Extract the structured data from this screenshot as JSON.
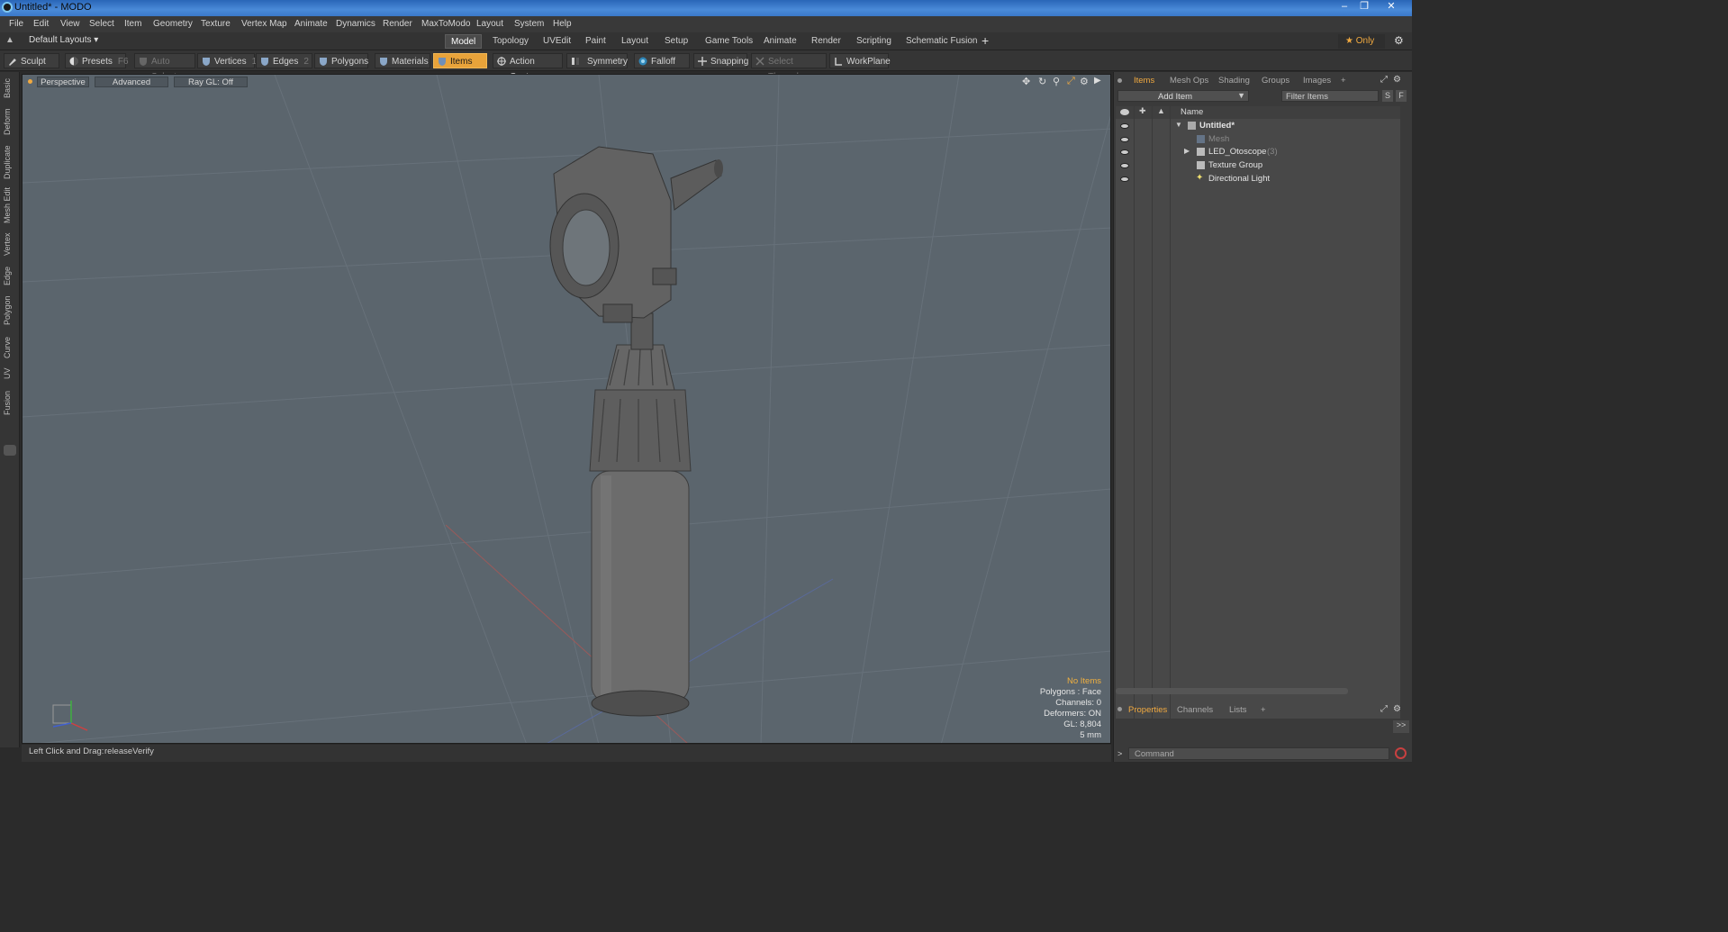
{
  "window": {
    "title": "Untitled* - MODO",
    "minimize": "‒",
    "restore": "❐",
    "close": "✕"
  },
  "menu": [
    "File",
    "Edit",
    "View",
    "Select",
    "Item",
    "Geometry",
    "Texture",
    "Vertex Map",
    "Animate",
    "Dynamics",
    "Render",
    "MaxToModo",
    "Layout",
    "System",
    "Help"
  ],
  "layout_selector": "Default Layouts ▾",
  "layout_tabs": [
    "Model",
    "Topology",
    "UVEdit",
    "Paint",
    "Layout",
    "Setup",
    "Game Tools",
    "Animate",
    "Render",
    "Scripting",
    "Schematic Fusion"
  ],
  "layout_tabs_active": "Model",
  "add_tab": "+",
  "only_label": "★  Only",
  "toolbar": {
    "sculpt": "Sculpt",
    "presets": "Presets",
    "presets_key": "F6",
    "auto_select": "Auto Select",
    "vertices": "Vertices",
    "vertices_count": "1",
    "edges": "Edges",
    "edges_count": "2",
    "polygons": "Polygons",
    "materials": "Materials",
    "items": "Items",
    "action_center": "Action Center",
    "symmetry": "Symmetry",
    "falloff": "Falloff",
    "snapping": "Snapping",
    "select_through": "Select Through",
    "workplane": "WorkPlane"
  },
  "left_tabs": [
    "Basic",
    "Deform",
    "Duplicate",
    "Mesh Edit",
    "Vertex",
    "Edge",
    "Polygon",
    "Curve",
    "UV",
    "Fusion"
  ],
  "viewport": {
    "perspective": "Perspective",
    "advanced": "Advanced",
    "raygl": "Ray GL: Off",
    "hud": {
      "no_items": "No Items",
      "polygons": "Polygons : Face",
      "channels": "Channels: 0",
      "deformers": "Deformers: ON",
      "gl": "GL: 8,804",
      "scale": "5 mm"
    }
  },
  "status": {
    "hint": "Left Click and Drag:",
    "value": "releaseVerify"
  },
  "right_panel": {
    "tabs": [
      "Items",
      "Mesh Ops",
      "Shading",
      "Groups",
      "Images",
      "+"
    ],
    "active_tab": "Items",
    "add_item": "Add Item",
    "filter_items": "Filter Items",
    "s_btn": "S",
    "f_btn": "F",
    "name_header": "Name",
    "items": [
      {
        "label": "Untitled*",
        "count": ""
      },
      {
        "label": "Mesh",
        "count": ""
      },
      {
        "label": "LED_Otoscope",
        "count": "(3)"
      },
      {
        "label": "Texture Group",
        "count": ""
      },
      {
        "label": "Directional Light",
        "count": ""
      }
    ],
    "bottom_tabs": [
      "Properties",
      "Channels",
      "Lists",
      "+"
    ],
    "bottom_active": "Properties",
    "command_placeholder": "Command",
    "expand": ">>"
  },
  "colors": {
    "accent": "#f0a940",
    "viewport_bg": "#5b656d",
    "active_tool": "#e8a33a"
  }
}
